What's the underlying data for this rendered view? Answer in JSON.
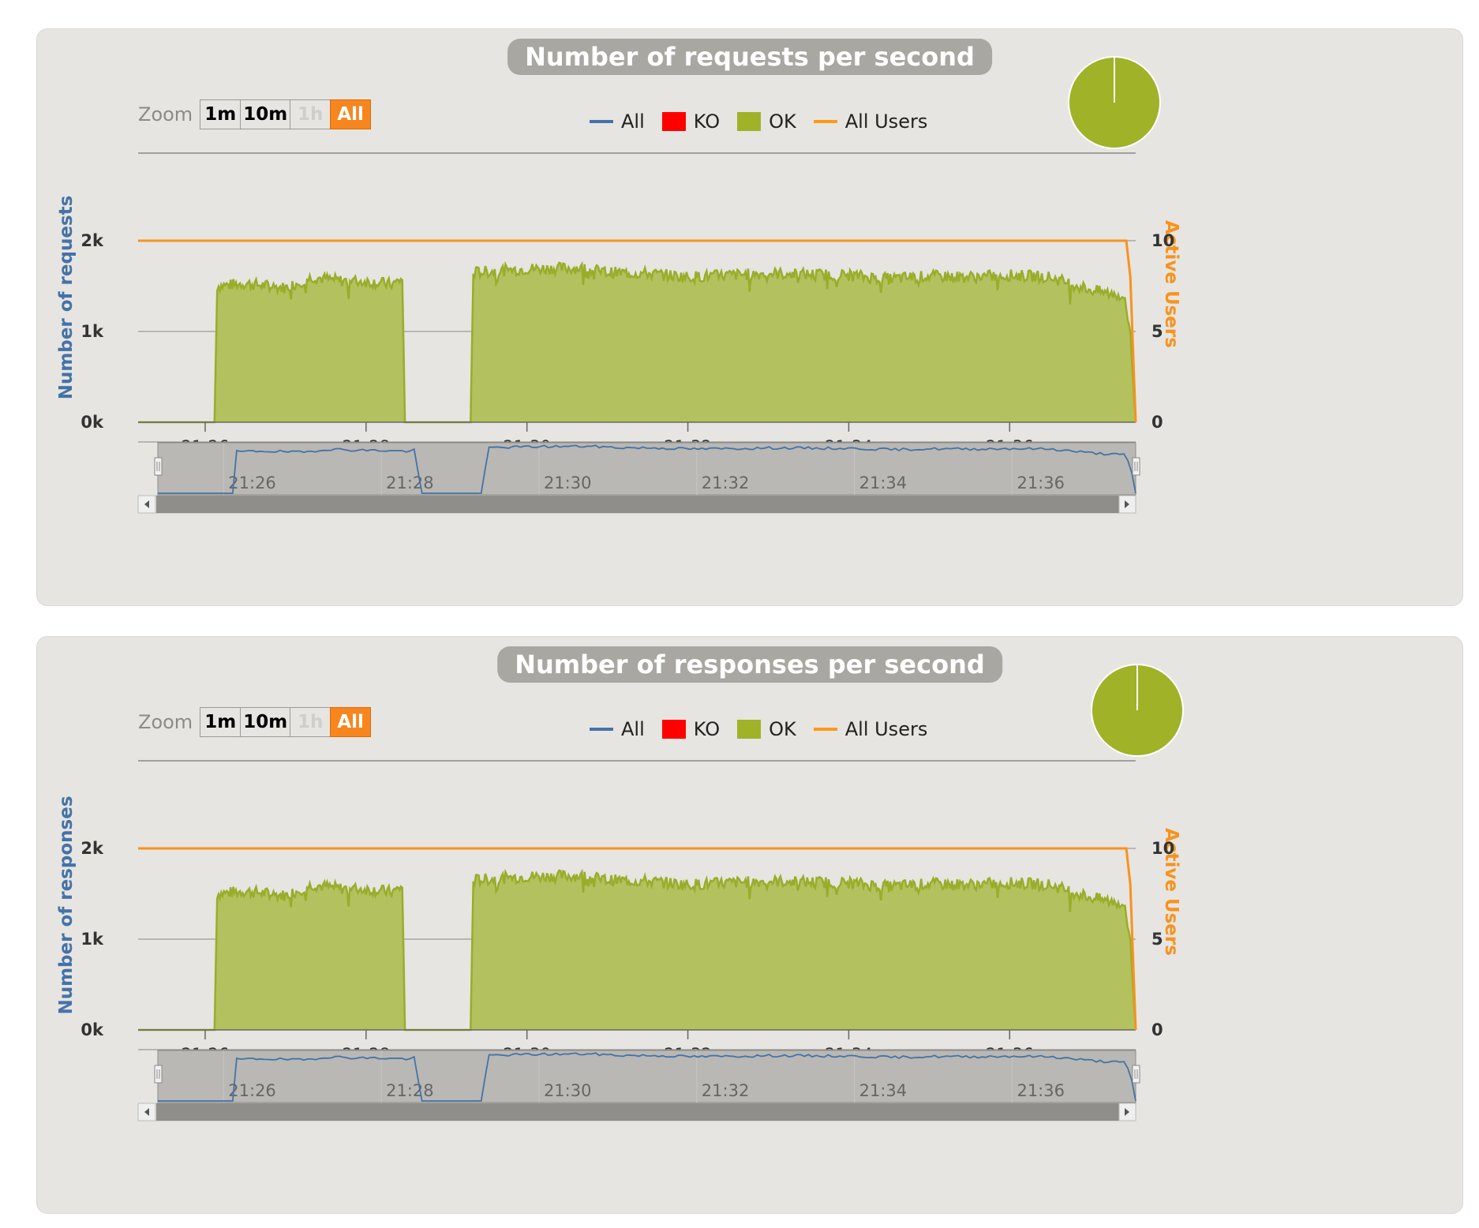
{
  "zoom": {
    "label": "Zoom",
    "buttons": [
      "1m",
      "10m",
      "1h",
      "All"
    ]
  },
  "legend": [
    {
      "label": "All",
      "color": "#4572a7",
      "symbol": "line"
    },
    {
      "label": "KO",
      "color": "#ff0000",
      "symbol": "box"
    },
    {
      "label": "OK",
      "color": "#a0b228",
      "symbol": "box"
    },
    {
      "label": "All Users",
      "color": "#ff9916",
      "symbol": "line"
    }
  ],
  "colors": {
    "ok_fill": "#b3c15e",
    "ok_line": "#9aad2a",
    "users_line": "#f7931e",
    "all_line": "#4572a7",
    "panel_bg": "#e6e5e1",
    "pie": "#a0b228"
  },
  "charts": [
    {
      "title": "Number of requests per second",
      "y_title": "Number of requests"
    },
    {
      "title": "Number of responses per second",
      "y_title": "Number of responses"
    }
  ],
  "chart_data": [
    {
      "type": "area",
      "title": "Number of requests per second",
      "ylabel": "Number of requests",
      "y2label": "Active Users",
      "yticks": [
        "0k",
        "1k",
        "2k"
      ],
      "y2ticks": [
        "0",
        "5",
        "10"
      ],
      "ylim": [
        0,
        2000
      ],
      "y2lim": [
        0,
        10
      ],
      "xticks": [
        "21:26",
        "21:28",
        "21:30",
        "21:32",
        "21:34",
        "21:36"
      ],
      "navigator_ticks": [
        "21:26",
        "21:28",
        "21:30",
        "21:32",
        "21:34",
        "21:36"
      ],
      "grid": true,
      "legend_position": "top-center",
      "series": [
        {
          "name": "OK",
          "points": [
            [
              "21:25:10",
              0
            ],
            [
              "21:26:07",
              0
            ],
            [
              "21:26:09",
              1500
            ],
            [
              "21:26:30",
              1530
            ],
            [
              "21:27:00",
              1480
            ],
            [
              "21:27:20",
              1600
            ],
            [
              "21:27:40",
              1560
            ],
            [
              "21:28:00",
              1550
            ],
            [
              "21:28:20",
              1520
            ],
            [
              "21:28:27",
              1580
            ],
            [
              "21:28:29",
              0
            ],
            [
              "21:29:18",
              0
            ],
            [
              "21:29:20",
              1650
            ],
            [
              "21:30:00",
              1690
            ],
            [
              "21:30:40",
              1700
            ],
            [
              "21:31:00",
              1650
            ],
            [
              "21:31:30",
              1640
            ],
            [
              "21:32:00",
              1600
            ],
            [
              "21:32:30",
              1620
            ],
            [
              "21:33:00",
              1640
            ],
            [
              "21:33:30",
              1630
            ],
            [
              "21:34:00",
              1620
            ],
            [
              "21:34:30",
              1580
            ],
            [
              "21:35:00",
              1610
            ],
            [
              "21:35:30",
              1600
            ],
            [
              "21:36:00",
              1620
            ],
            [
              "21:36:30",
              1600
            ],
            [
              "21:37:00",
              1460
            ],
            [
              "21:37:25",
              1390
            ],
            [
              "21:37:30",
              1000
            ],
            [
              "21:37:34",
              0
            ]
          ]
        },
        {
          "name": "KO",
          "points": []
        },
        {
          "name": "All Users",
          "points": [
            [
              "21:25:10",
              10
            ],
            [
              "21:37:27",
              10
            ],
            [
              "21:37:30",
              8
            ],
            [
              "21:37:34",
              0
            ]
          ]
        }
      ]
    },
    {
      "type": "area",
      "title": "Number of responses per second",
      "ylabel": "Number of responses",
      "y2label": "Active Users",
      "yticks": [
        "0k",
        "1k",
        "2k"
      ],
      "y2ticks": [
        "0",
        "5",
        "10"
      ],
      "ylim": [
        0,
        2000
      ],
      "y2lim": [
        0,
        10
      ],
      "xticks": [
        "21:26",
        "21:28",
        "21:30",
        "21:32",
        "21:34",
        "21:36"
      ],
      "navigator_ticks": [
        "21:26",
        "21:28",
        "21:30",
        "21:32",
        "21:34",
        "21:36"
      ],
      "grid": true,
      "legend_position": "top-center",
      "series": [
        {
          "name": "OK",
          "points": [
            [
              "21:25:10",
              0
            ],
            [
              "21:26:07",
              0
            ],
            [
              "21:26:09",
              1500
            ],
            [
              "21:26:30",
              1530
            ],
            [
              "21:27:00",
              1480
            ],
            [
              "21:27:20",
              1600
            ],
            [
              "21:27:40",
              1560
            ],
            [
              "21:28:00",
              1550
            ],
            [
              "21:28:20",
              1520
            ],
            [
              "21:28:27",
              1580
            ],
            [
              "21:28:29",
              0
            ],
            [
              "21:29:18",
              0
            ],
            [
              "21:29:20",
              1650
            ],
            [
              "21:30:00",
              1690
            ],
            [
              "21:30:40",
              1700
            ],
            [
              "21:31:00",
              1650
            ],
            [
              "21:31:30",
              1640
            ],
            [
              "21:32:00",
              1600
            ],
            [
              "21:32:30",
              1620
            ],
            [
              "21:33:00",
              1640
            ],
            [
              "21:33:30",
              1630
            ],
            [
              "21:34:00",
              1620
            ],
            [
              "21:34:30",
              1580
            ],
            [
              "21:35:00",
              1610
            ],
            [
              "21:35:30",
              1600
            ],
            [
              "21:36:00",
              1620
            ],
            [
              "21:36:30",
              1600
            ],
            [
              "21:37:00",
              1460
            ],
            [
              "21:37:25",
              1390
            ],
            [
              "21:37:30",
              1000
            ],
            [
              "21:37:34",
              0
            ]
          ]
        },
        {
          "name": "KO",
          "points": []
        },
        {
          "name": "All Users",
          "points": [
            [
              "21:25:10",
              10
            ],
            [
              "21:37:27",
              10
            ],
            [
              "21:37:30",
              8
            ],
            [
              "21:37:34",
              0
            ]
          ]
        }
      ]
    }
  ]
}
